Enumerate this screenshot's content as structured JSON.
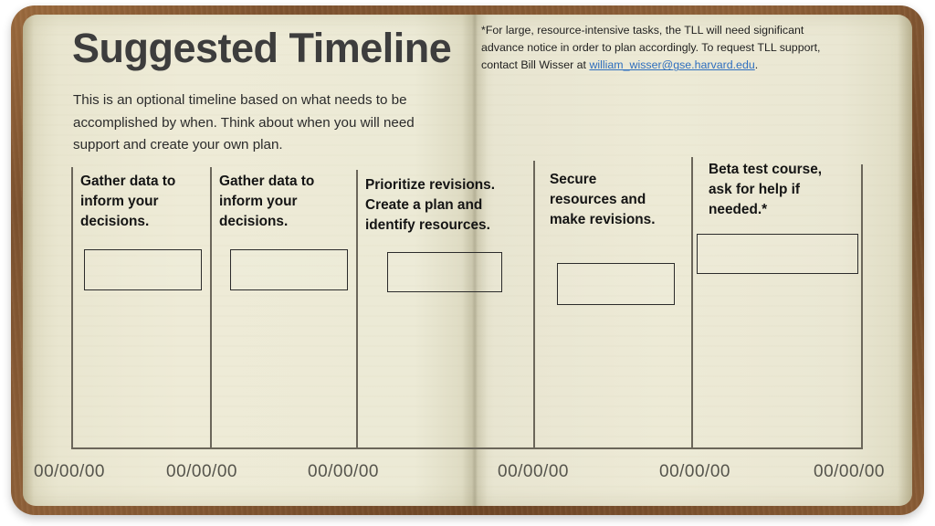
{
  "document": {
    "title": "Suggested Timeline",
    "intro": "This is an optional timeline based on what needs to be accomplished by when. Think about when you will need support and create your own plan.",
    "footnote": {
      "before_email": "*For large, resource-intensive tasks, the TLL will need significant advance notice in order to plan accordingly. To request TLL support, contact Bill Wisser at ",
      "email": "william_wisser@gse.harvard.edu",
      "after_email": "."
    }
  },
  "timeline": {
    "columns": [
      {
        "heading": "Gather data to inform your decisions.",
        "date": "00/00/00"
      },
      {
        "heading": "Gather data to inform your decisions.",
        "date": "00/00/00"
      },
      {
        "heading": "Prioritize revisions. Create a plan and identify resources.",
        "date": "00/00/00"
      },
      {
        "heading": "Secure resources and make revisions.",
        "date": "00/00/00"
      },
      {
        "heading": "Beta test course, ask for help if needed.*",
        "date": "00/00/00"
      },
      {
        "heading": "",
        "date": "00/00/00"
      }
    ]
  },
  "colors": {
    "page": "#ecead6",
    "cover": "#8a5d36",
    "link": "#2f6fbf",
    "rule": "#6b665a",
    "title": "#3d3d3d",
    "date": "#55544c"
  }
}
